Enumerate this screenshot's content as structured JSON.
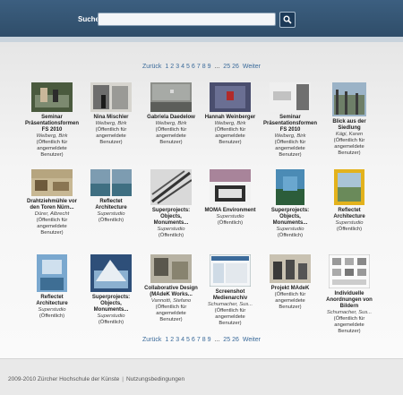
{
  "header": {
    "search_label": "Suche",
    "search_value": "",
    "search_icon": "magnifier-icon"
  },
  "pagination": {
    "prev": "Zurück",
    "pages": [
      "1",
      "2",
      "3",
      "4",
      "5",
      "6",
      "7",
      "8",
      "9"
    ],
    "ellipsis": "...",
    "tail_pages": [
      "25",
      "26"
    ],
    "next": "Weiter"
  },
  "items": [
    {
      "title": "Seminar Präsentationsformen FS 2010",
      "author": "Weiberg, Birk",
      "permission": "(Öffentlich für angemeldete Benutzer)"
    },
    {
      "title": "Nina Mischler",
      "author": "Weiberg, Birk",
      "permission": "(Öffentlich für angemeldete Benutzer)"
    },
    {
      "title": "Gabriela Daedelow",
      "author": "Weiberg, Birk",
      "permission": "(Öffentlich für angemeldete Benutzer)"
    },
    {
      "title": "Hannah Weinberger",
      "author": "Weiberg, Birk",
      "permission": "(Öffentlich für angemeldete Benutzer)"
    },
    {
      "title": "Seminar Präsentationsformen FS 2010",
      "author": "Weiberg, Birk",
      "permission": "(Öffentlich für angemeldete Benutzer)"
    },
    {
      "title": "Blick aus der Siedlung",
      "author": "Kägi, Karen",
      "permission": "(Öffentlich für angemeldete Benutzer)"
    },
    {
      "title": "Drahtziehmühle vor den Toren Nürn...",
      "author": "Dürer, Albrecht",
      "permission": "(Öffentlich für angemeldete Benutzer)"
    },
    {
      "title": "Reflectet Architecture",
      "author": "Superstudio",
      "permission": "(Öffentlich)"
    },
    {
      "title": "Superprojects: Objects, Monuments...",
      "author": "Superstudio",
      "permission": "(Öffentlich)"
    },
    {
      "title": "MOMA Environment",
      "author": "Superstudio",
      "permission": "(Öffentlich)"
    },
    {
      "title": "Superprojects: Objects, Monuments...",
      "author": "Superstudio",
      "permission": "(Öffentlich)"
    },
    {
      "title": "Reflectet Architecture",
      "author": "Superstudio",
      "permission": "(Öffentlich)"
    },
    {
      "title": "Reflectet Architecture",
      "author": "Superstudio",
      "permission": "(Öffentlich)"
    },
    {
      "title": "Superprojects: Objects, Monuments...",
      "author": "Superstudio",
      "permission": "(Öffentlich)"
    },
    {
      "title": "Collaborative Design (MAdeK Works...",
      "author": "Vannotti, Stefano",
      "permission": "(Öffentlich für angemeldete Benutzer)"
    },
    {
      "title": "Screenshot Medienarchiv",
      "author": "Schumacher, Sus...",
      "permission": "(Öffentlich für angemeldete Benutzer)"
    },
    {
      "title": "Projekt MAdeK",
      "author": "",
      "permission": "(Öffentlich für angemeldete Benutzer)"
    },
    {
      "title": "Individuelle Anordnungen von Bildern",
      "author": "Schumacher, Sus...",
      "permission": "(Öffentlich für angemeldete Benutzer)"
    }
  ],
  "footer": {
    "copyright": "2009-2010 Zürcher Hochschule der Künste",
    "separator": "|",
    "link": "Nutzungsbedingungen"
  }
}
